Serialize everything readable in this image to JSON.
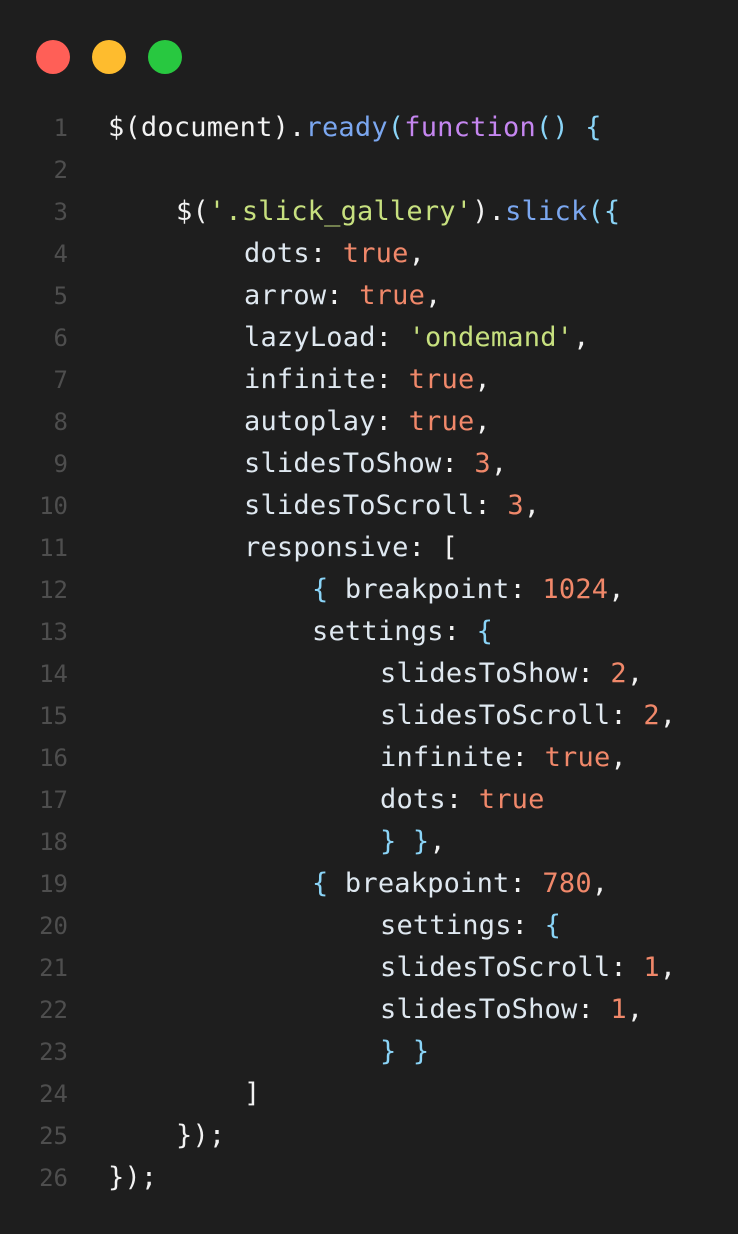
{
  "window": {
    "controls": [
      {
        "name": "close",
        "color": "#ff5f57"
      },
      {
        "name": "minimize",
        "color": "#febc2e"
      },
      {
        "name": "zoom",
        "color": "#28c840"
      }
    ]
  },
  "code": {
    "language": "javascript",
    "lines": [
      {
        "n": "1",
        "indent": 0,
        "tokens": [
          [
            "white",
            "$("
          ],
          [
            "white",
            "document"
          ],
          [
            "white",
            ")."
          ],
          [
            "method",
            "ready"
          ],
          [
            "punc",
            "("
          ],
          [
            "keyword",
            "function"
          ],
          [
            "punc",
            "() {"
          ]
        ]
      },
      {
        "n": "2",
        "indent": 0,
        "tokens": []
      },
      {
        "n": "3",
        "indent": 4,
        "tokens": [
          [
            "white",
            "$("
          ],
          [
            "string",
            "'.slick_gallery'"
          ],
          [
            "white",
            ")."
          ],
          [
            "method",
            "slick"
          ],
          [
            "punc",
            "({"
          ]
        ]
      },
      {
        "n": "4",
        "indent": 8,
        "tokens": [
          [
            "prop",
            "dots"
          ],
          [
            "white",
            ": "
          ],
          [
            "bool",
            "true"
          ],
          [
            "white",
            ","
          ]
        ]
      },
      {
        "n": "5",
        "indent": 8,
        "tokens": [
          [
            "prop",
            "arrow"
          ],
          [
            "white",
            ": "
          ],
          [
            "bool",
            "true"
          ],
          [
            "white",
            ","
          ]
        ]
      },
      {
        "n": "6",
        "indent": 8,
        "tokens": [
          [
            "prop",
            "lazyLoad"
          ],
          [
            "white",
            ": "
          ],
          [
            "string",
            "'ondemand'"
          ],
          [
            "white",
            ","
          ]
        ]
      },
      {
        "n": "7",
        "indent": 8,
        "tokens": [
          [
            "prop",
            "infinite"
          ],
          [
            "white",
            ": "
          ],
          [
            "bool",
            "true"
          ],
          [
            "white",
            ","
          ]
        ]
      },
      {
        "n": "8",
        "indent": 8,
        "tokens": [
          [
            "prop",
            "autoplay"
          ],
          [
            "white",
            ": "
          ],
          [
            "bool",
            "true"
          ],
          [
            "white",
            ","
          ]
        ]
      },
      {
        "n": "9",
        "indent": 8,
        "tokens": [
          [
            "prop",
            "slidesToShow"
          ],
          [
            "white",
            ": "
          ],
          [
            "num",
            "3"
          ],
          [
            "white",
            ","
          ]
        ]
      },
      {
        "n": "10",
        "indent": 8,
        "tokens": [
          [
            "prop",
            "slidesToScroll"
          ],
          [
            "white",
            ": "
          ],
          [
            "num",
            "3"
          ],
          [
            "white",
            ","
          ]
        ]
      },
      {
        "n": "11",
        "indent": 8,
        "tokens": [
          [
            "prop",
            "responsive"
          ],
          [
            "white",
            ": ["
          ]
        ]
      },
      {
        "n": "12",
        "indent": 12,
        "tokens": [
          [
            "punc",
            "{ "
          ],
          [
            "prop",
            "breakpoint"
          ],
          [
            "white",
            ": "
          ],
          [
            "num",
            "1024"
          ],
          [
            "white",
            ","
          ]
        ]
      },
      {
        "n": "13",
        "indent": 12,
        "tokens": [
          [
            "prop",
            "settings"
          ],
          [
            "white",
            ": "
          ],
          [
            "punc",
            "{"
          ]
        ]
      },
      {
        "n": "14",
        "indent": 16,
        "tokens": [
          [
            "prop",
            "slidesToShow"
          ],
          [
            "white",
            ": "
          ],
          [
            "num",
            "2"
          ],
          [
            "white",
            ","
          ]
        ]
      },
      {
        "n": "15",
        "indent": 16,
        "tokens": [
          [
            "prop",
            "slidesToScroll"
          ],
          [
            "white",
            ": "
          ],
          [
            "num",
            "2"
          ],
          [
            "white",
            ","
          ]
        ]
      },
      {
        "n": "16",
        "indent": 16,
        "tokens": [
          [
            "prop",
            "infinite"
          ],
          [
            "white",
            ": "
          ],
          [
            "bool",
            "true"
          ],
          [
            "white",
            ","
          ]
        ]
      },
      {
        "n": "17",
        "indent": 16,
        "tokens": [
          [
            "prop",
            "dots"
          ],
          [
            "white",
            ": "
          ],
          [
            "bool",
            "true"
          ]
        ]
      },
      {
        "n": "18",
        "indent": 16,
        "tokens": [
          [
            "punc",
            "} }"
          ],
          [
            "white",
            ","
          ]
        ]
      },
      {
        "n": "19",
        "indent": 12,
        "tokens": [
          [
            "punc",
            "{ "
          ],
          [
            "prop",
            "breakpoint"
          ],
          [
            "white",
            ": "
          ],
          [
            "num",
            "780"
          ],
          [
            "white",
            ","
          ]
        ]
      },
      {
        "n": "20",
        "indent": 16,
        "tokens": [
          [
            "prop",
            "settings"
          ],
          [
            "white",
            ": "
          ],
          [
            "punc",
            "{"
          ]
        ]
      },
      {
        "n": "21",
        "indent": 16,
        "tokens": [
          [
            "prop",
            "slidesToScroll"
          ],
          [
            "white",
            ": "
          ],
          [
            "num",
            "1"
          ],
          [
            "white",
            ","
          ]
        ]
      },
      {
        "n": "22",
        "indent": 16,
        "tokens": [
          [
            "prop",
            "slidesToShow"
          ],
          [
            "white",
            ": "
          ],
          [
            "num",
            "1"
          ],
          [
            "white",
            ","
          ]
        ]
      },
      {
        "n": "23",
        "indent": 16,
        "tokens": [
          [
            "punc",
            "} }"
          ]
        ]
      },
      {
        "n": "24",
        "indent": 8,
        "tokens": [
          [
            "white",
            "]"
          ]
        ]
      },
      {
        "n": "25",
        "indent": 4,
        "tokens": [
          [
            "white",
            "});"
          ]
        ]
      },
      {
        "n": "26",
        "indent": 0,
        "tokens": [
          [
            "white",
            "});"
          ]
        ]
      }
    ]
  }
}
